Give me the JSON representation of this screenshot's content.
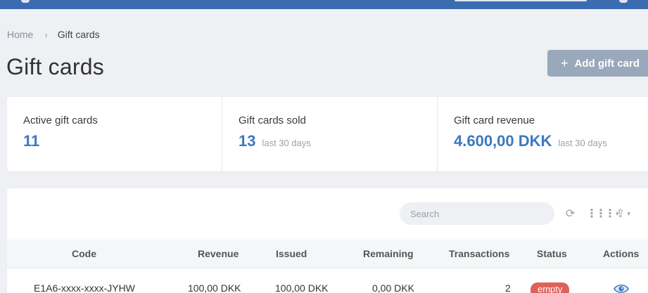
{
  "breadcrumb": {
    "home": "Home",
    "separator": "›",
    "current": "Gift cards"
  },
  "page": {
    "title": "Gift cards",
    "add_button": "Add gift card",
    "add_button_icon": "+"
  },
  "stats": [
    {
      "label": "Active gift cards",
      "value": "11",
      "note": ""
    },
    {
      "label": "Gift cards sold",
      "value": "13",
      "note": "last 30 days"
    },
    {
      "label": "Gift card revenue",
      "value": "4.600,00 DKK",
      "note": "last 30 days"
    }
  ],
  "toolbar": {
    "search_placeholder": "Search",
    "refresh_icon": "⟳",
    "columns_icon": "⋮⋮⋮",
    "export_icon": "⇪",
    "caret": "▾"
  },
  "table": {
    "headers": [
      "Code",
      "Revenue",
      "Issued",
      "Remaining",
      "Transactions",
      "Status",
      "Actions"
    ],
    "rows": [
      {
        "code": "E1A6-xxxx-xxxx-JYHW",
        "revenue": "100,00 DKK",
        "issued": "100,00 DKK",
        "remaining": "0,00 DKK",
        "transactions": "2",
        "status": "empty"
      }
    ]
  },
  "colors": {
    "accent": "#3d78c0",
    "topbar": "#3b6cb0",
    "badge_empty": "#e0615b",
    "button": "#9aa8bb"
  }
}
